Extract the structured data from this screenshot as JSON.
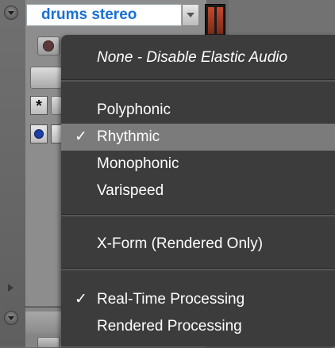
{
  "track": {
    "name": "drums stereo"
  },
  "menu": {
    "header_item": "None - Disable Elastic Audio",
    "items": [
      {
        "label": "Polyphonic",
        "checked": false
      },
      {
        "label": "Rhythmic",
        "checked": true,
        "highlighted": true
      },
      {
        "label": "Monophonic",
        "checked": false
      },
      {
        "label": "Varispeed",
        "checked": false
      }
    ],
    "xform_item": "X-Form (Rendered Only)",
    "processing_items": [
      {
        "label": "Real-Time Processing",
        "checked": true
      },
      {
        "label": "Rendered Processing",
        "checked": false
      }
    ],
    "check_glyph": "✓"
  },
  "icons": {
    "asterisk": "*"
  },
  "colors": {
    "menu_bg": "#3c3c3c",
    "menu_highlight": "#7b7b7b",
    "track_name_text": "#1a6fd6"
  }
}
